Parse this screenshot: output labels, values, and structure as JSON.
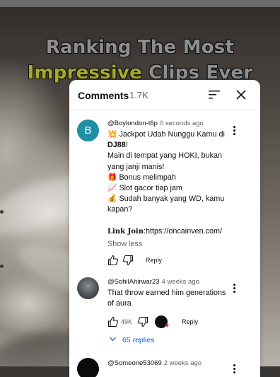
{
  "video": {
    "title_line1": "Ranking The Most",
    "title_line2_highlight": "Impressive",
    "title_line2_rest": " Clips Ever"
  },
  "comments_panel": {
    "title": "Comments",
    "count": "1.7K",
    "sort_icon": "sort-icon",
    "close_icon": "close-icon"
  },
  "comments": [
    {
      "avatar_letter": "B",
      "author": "@Boylondon-t6p",
      "time": "0 seconds ago",
      "lines": [
        {
          "icon": "💥",
          "text": " Jackpot Udah Nunggu Kamu di"
        },
        {
          "bold": "DJ88",
          "text": "!"
        },
        {
          "text": "Main di tempat yang HOKI, bukan"
        },
        {
          "text": "yang janji manis!"
        },
        {
          "icon": "🎁",
          "text": " Bonus melimpah"
        },
        {
          "icon": "📈",
          "text": " Slot gacor tiap jam"
        },
        {
          "icon": "💰",
          "text": " Sudah banyak yang WD, kamu"
        },
        {
          "text": "kapan?"
        },
        {
          "text": ""
        },
        {
          "label": "Link Join",
          "text": ":https://oncainven.com/"
        }
      ],
      "show_less": "Show less",
      "likes": "",
      "reply_label": "Reply"
    },
    {
      "author": "@SohilAhirwar23",
      "time": "4 weeks ago",
      "lines": [
        {
          "text": "That throw earned him generations"
        },
        {
          "text": "of aura"
        }
      ],
      "likes": "49K",
      "reply_label": "Reply",
      "replies_label": "65 replies"
    },
    {
      "author": "@Someone53069",
      "time": "2 weeks ago"
    }
  ],
  "colors": {
    "accent_link": "#065fd4",
    "avatar_b": "#1f8fa6",
    "title_highlight": "#a8a82a"
  }
}
